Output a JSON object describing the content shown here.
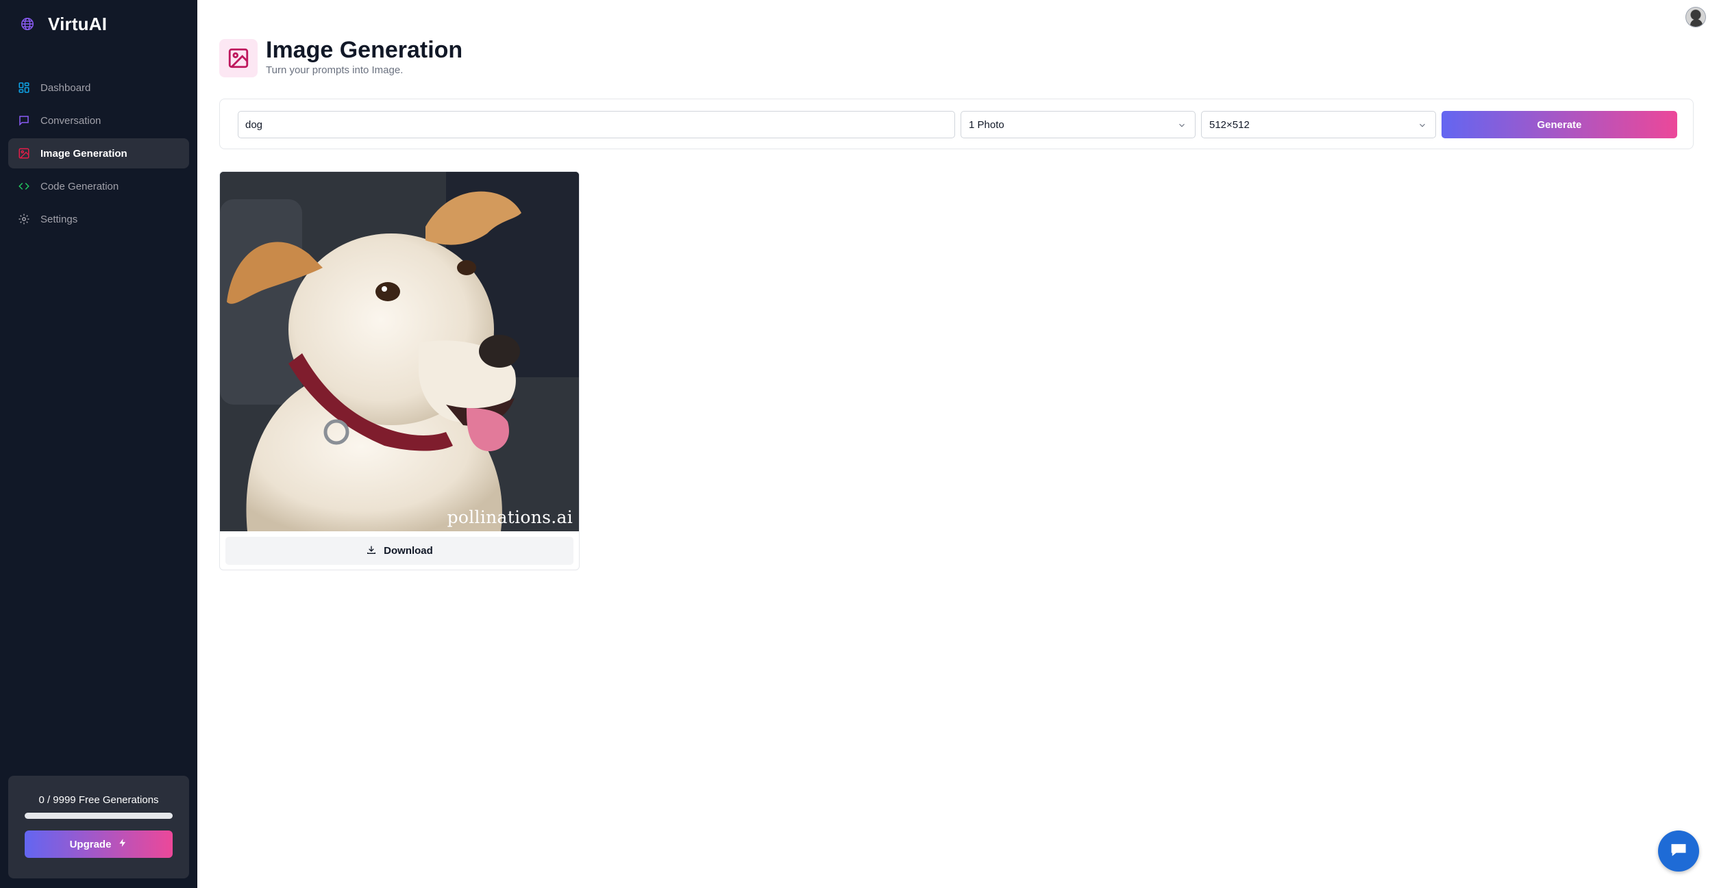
{
  "app": {
    "name": "VirtuAI"
  },
  "sidebar": {
    "items": [
      {
        "label": "Dashboard",
        "icon": "dashboard-icon",
        "active": false
      },
      {
        "label": "Conversation",
        "icon": "chat-bubble-icon",
        "active": false
      },
      {
        "label": "Image Generation",
        "icon": "image-icon",
        "active": true
      },
      {
        "label": "Code Generation",
        "icon": "code-icon",
        "active": false
      },
      {
        "label": "Settings",
        "icon": "gear-icon",
        "active": false
      }
    ],
    "usage": {
      "text": "0 / 9999 Free Generations",
      "used": 0,
      "limit": 9999
    },
    "upgrade_label": "Upgrade"
  },
  "header": {
    "title": "Image Generation",
    "subtitle": "Turn your prompts into Image."
  },
  "form": {
    "prompt_value": "dog",
    "amount_selected": "1 Photo",
    "resolution_selected": "512×512",
    "generate_label": "Generate"
  },
  "results": [
    {
      "watermark": "pollinations.ai",
      "download_label": "Download"
    }
  ],
  "colors": {
    "sidebar_bg": "#111827",
    "active_item_bg": "#2a2f3b",
    "gradient_start": "#6366f1",
    "gradient_end": "#ec4899",
    "image_accent": "#e11d48",
    "chat_button": "#1e6bd6"
  }
}
